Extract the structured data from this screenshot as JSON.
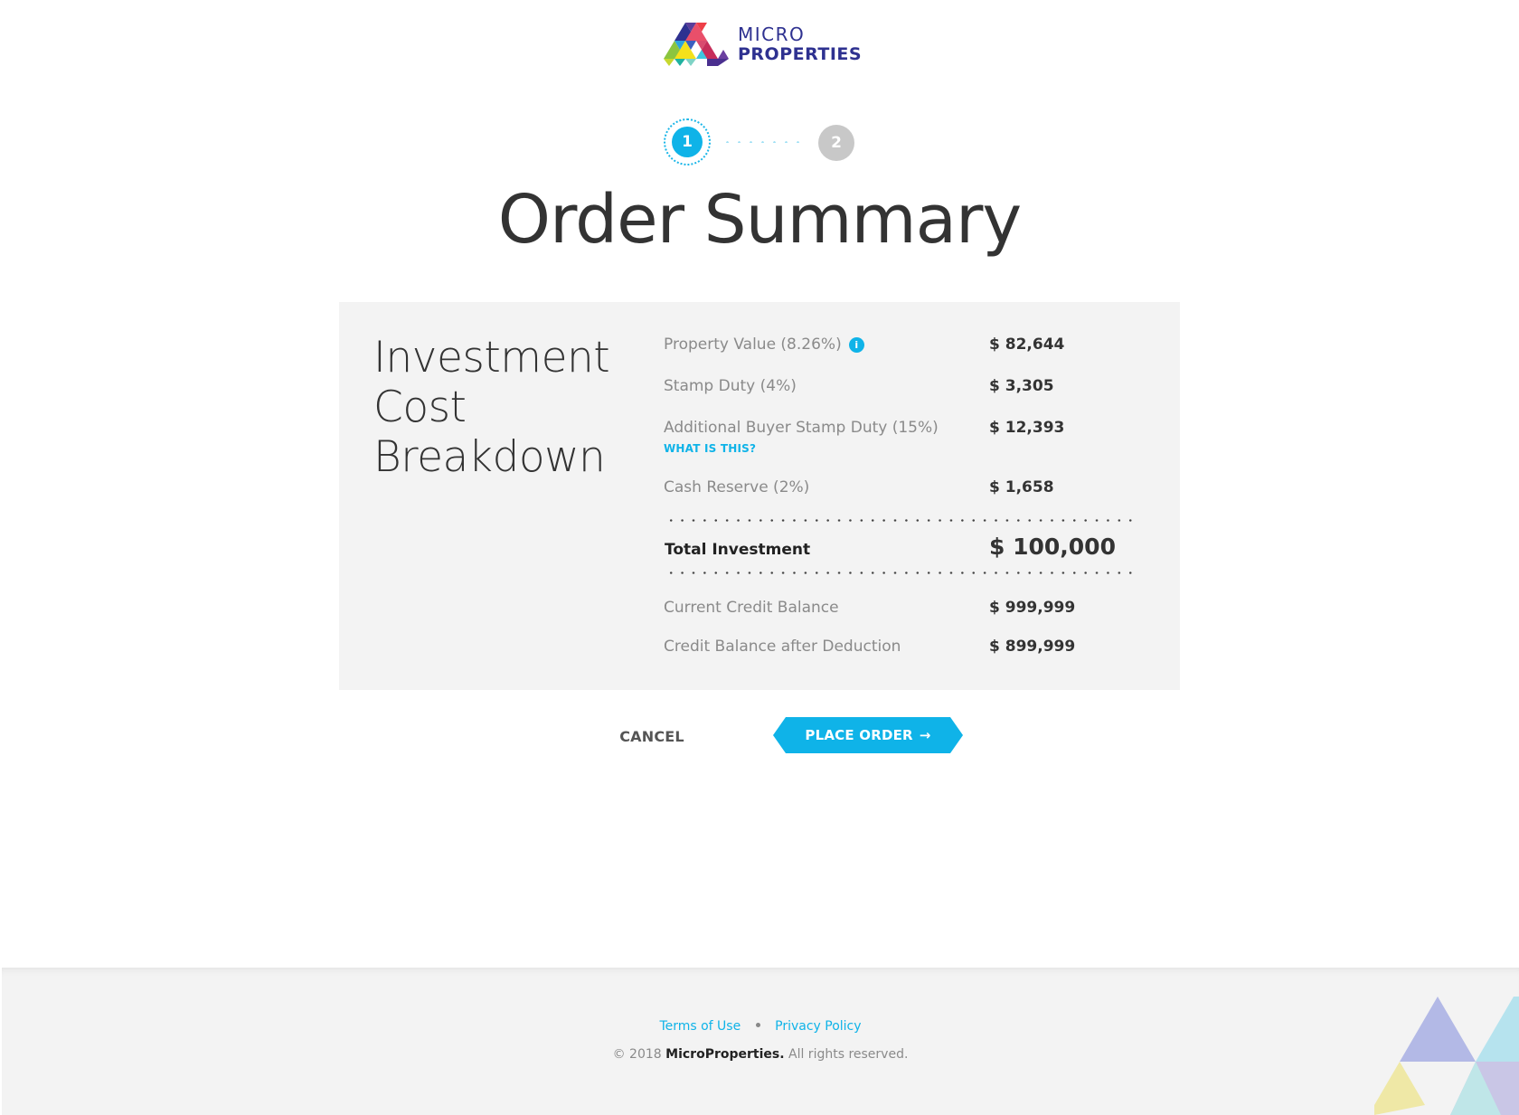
{
  "brand": {
    "name_line1": "MICRO",
    "name_line2": "PROPERTIES",
    "primary_color": "#2e3190",
    "accent_color": "#0fb3e8"
  },
  "stepper": {
    "steps": [
      {
        "number": "1",
        "state": "active"
      },
      {
        "number": "2",
        "state": "inactive"
      }
    ]
  },
  "page_title": "Order Summary",
  "card": {
    "heading_lines": [
      "Investment",
      "Cost",
      "Breakdown"
    ],
    "rows": [
      {
        "label": "Property Value (8.26%)",
        "value": "$ 82,644",
        "icon": "info-icon"
      },
      {
        "label": "Stamp Duty (4%)",
        "value": "$ 3,305"
      },
      {
        "label": "Additional Buyer Stamp Duty (15%)",
        "value": "$ 12,393",
        "link": "WHAT IS THIS?"
      },
      {
        "label": "Cash Reserve (2%)",
        "value": "$ 1,658"
      }
    ],
    "total": {
      "label": "Total Investment",
      "value": "$ 100,000"
    },
    "balances": [
      {
        "label": "Current Credit Balance",
        "value": "$ 999,999"
      },
      {
        "label": "Credit Balance after Deduction",
        "value": "$ 899,999"
      }
    ]
  },
  "actions": {
    "cancel_label": "CANCEL",
    "place_order_label": "PLACE ORDER",
    "place_order_icon": "arrow-right-icon"
  },
  "footer": {
    "terms_label": "Terms of Use",
    "privacy_label": "Privacy Policy",
    "copyright_prefix": "© 2018",
    "copyright_brand": "MicroProperties.",
    "copyright_suffix": "All rights reserved."
  }
}
